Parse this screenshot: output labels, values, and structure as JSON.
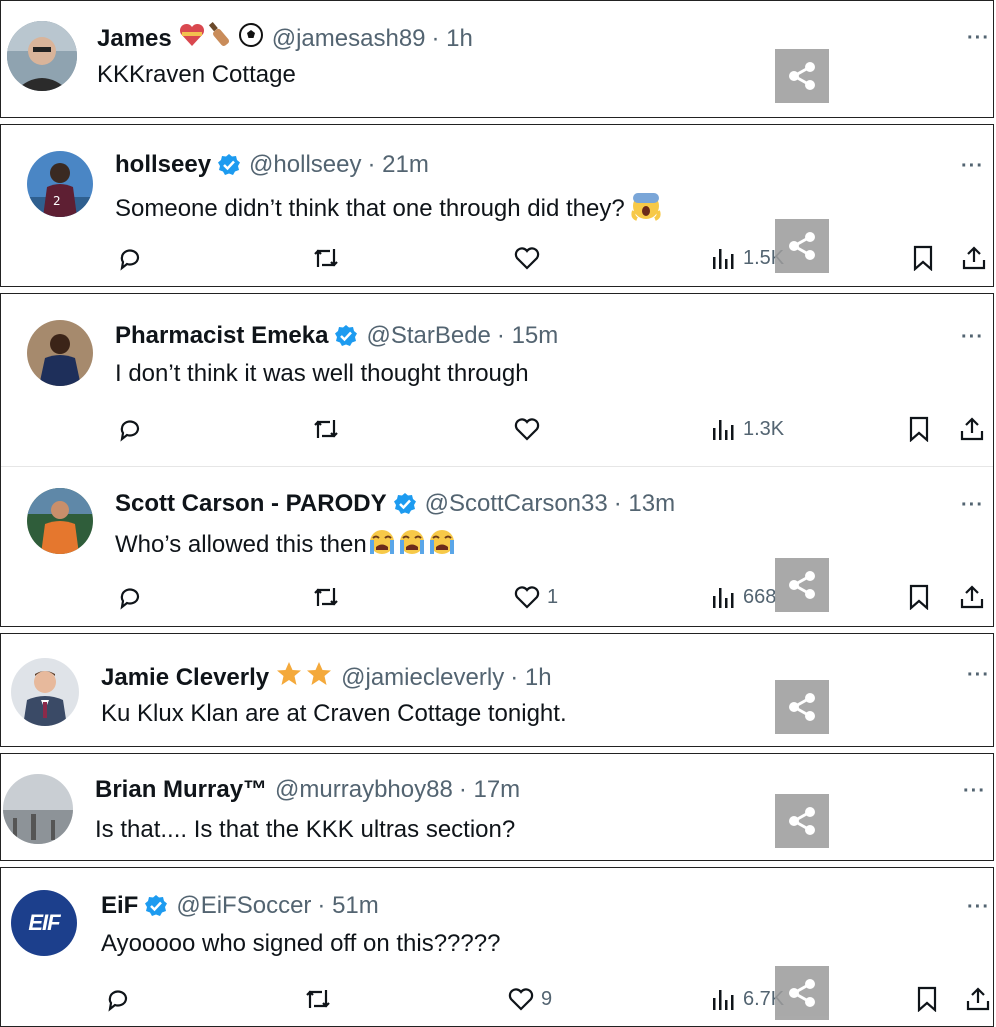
{
  "tweets": [
    {
      "name": "James",
      "handle": "@jamesash89",
      "time": "· 1h",
      "text": "KKKraven Cottage",
      "more": "···",
      "share_icon": "share-icon"
    },
    {
      "name": "hollseey",
      "handle": "@hollseey",
      "time": "· 21m",
      "text": "Someone didn’t think that one through did they?",
      "more": "···",
      "views": "1.5K"
    },
    {
      "name": "Pharmacist Emeka",
      "handle": "@StarBede",
      "time": "· 15m",
      "text": "I don’t think it was well thought through",
      "more": "···",
      "views": "1.3K"
    },
    {
      "name": "Scott Carson - PARODY",
      "handle": "@ScottCarson33",
      "time": "· 13m",
      "text": "Who’s allowed this then",
      "more": "···",
      "likes": "1",
      "views": "668"
    },
    {
      "name": "Jamie Cleverly",
      "handle": "@jamiecleverly",
      "time": "· 1h",
      "text": "Ku Klux Klan are at Craven Cottage tonight.",
      "more": "···"
    },
    {
      "name": "Brian Murray™",
      "handle": "@murraybhoy88",
      "time": "· 17m",
      "text": "Is that.... Is that the KKK ultras section?",
      "more": "···"
    },
    {
      "name": "EiF",
      "handle": "@EiFSoccer",
      "time": "· 51m",
      "text": "Ayooooo who signed off on this?????",
      "more": "···",
      "likes": "9",
      "views": "6.7K",
      "logo_text": "EIF"
    }
  ],
  "colors": {
    "verified": "#1d9bf0",
    "muted": "#536471",
    "star": "#f4a93b",
    "share_bg": "#9b9b9b"
  }
}
